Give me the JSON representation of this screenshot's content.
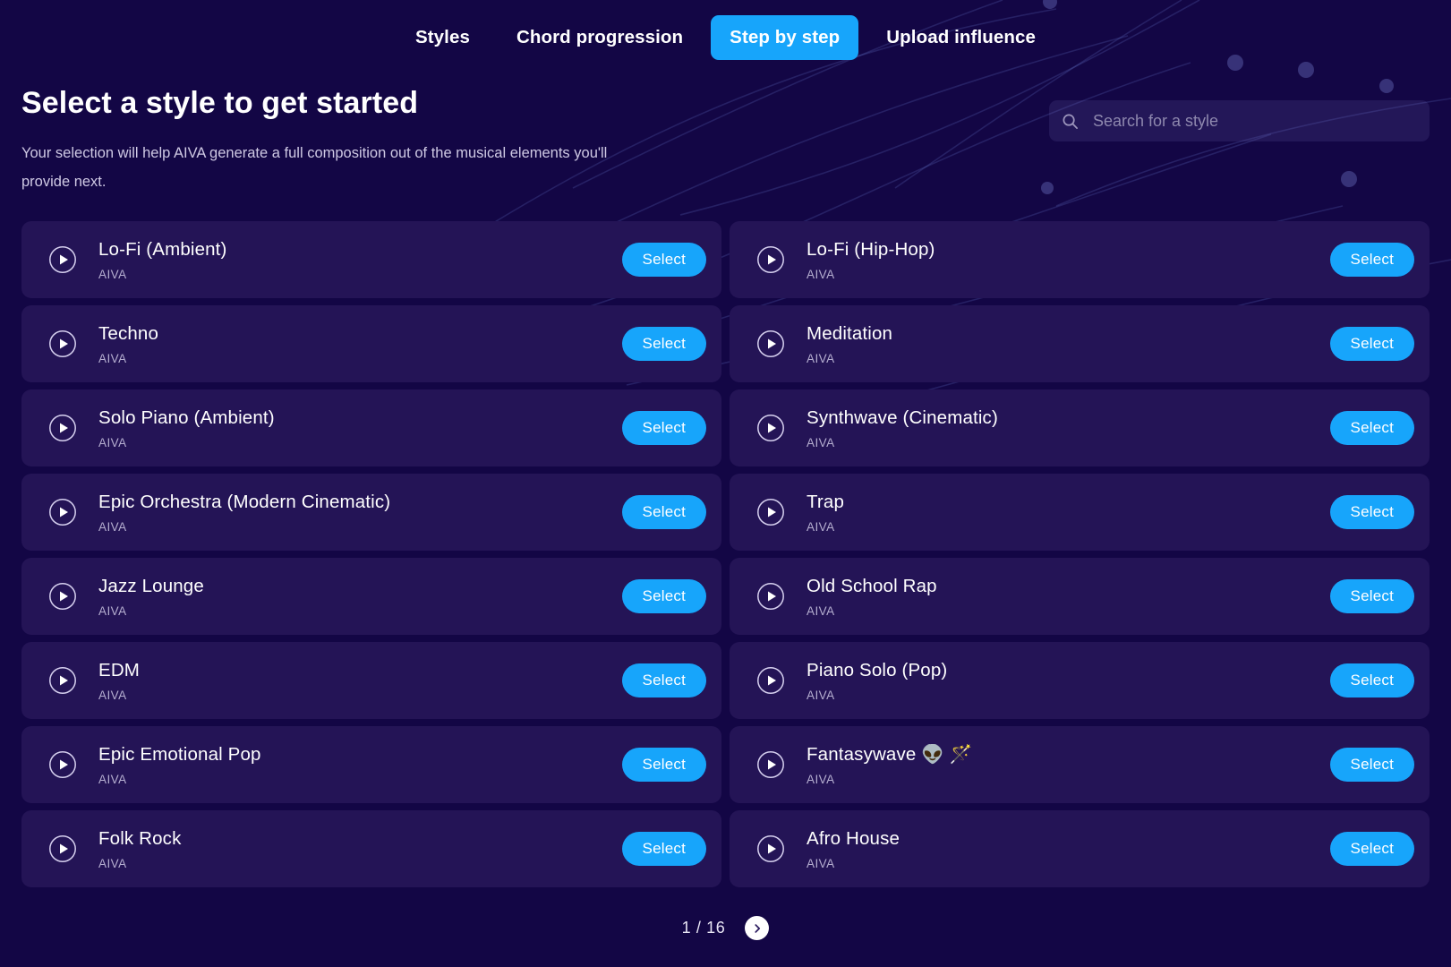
{
  "theme": {
    "background": "#130645",
    "card_background": "#241456",
    "accent": "#17a5fb",
    "title_color": "#ffffff",
    "subtitle_color": "#cfc9e4"
  },
  "tabs": [
    {
      "label": "Styles",
      "active": false
    },
    {
      "label": "Chord progression",
      "active": false
    },
    {
      "label": "Step by step",
      "active": true
    },
    {
      "label": "Upload influence",
      "active": false
    }
  ],
  "header": {
    "title": "Select a style to get started",
    "description": "Your selection will help AIVA generate a full composition out of the musical elements you'll provide next."
  },
  "search": {
    "icon": "search-icon",
    "placeholder": "Search for a style",
    "value": ""
  },
  "styles": [
    {
      "title": "Lo-Fi (Ambient)",
      "author": "AIVA",
      "select_label": "Select",
      "play_icon": "play-circle-icon"
    },
    {
      "title": "Lo-Fi (Hip-Hop)",
      "author": "AIVA",
      "select_label": "Select",
      "play_icon": "play-circle-icon"
    },
    {
      "title": "Techno",
      "author": "AIVA",
      "select_label": "Select",
      "play_icon": "play-circle-icon"
    },
    {
      "title": "Meditation",
      "author": "AIVA",
      "select_label": "Select",
      "play_icon": "play-circle-icon"
    },
    {
      "title": "Solo Piano (Ambient)",
      "author": "AIVA",
      "select_label": "Select",
      "play_icon": "play-circle-icon"
    },
    {
      "title": "Synthwave (Cinematic)",
      "author": "AIVA",
      "select_label": "Select",
      "play_icon": "play-circle-icon"
    },
    {
      "title": "Epic Orchestra (Modern Cinematic)",
      "author": "AIVA",
      "select_label": "Select",
      "play_icon": "play-circle-icon"
    },
    {
      "title": "Trap",
      "author": "AIVA",
      "select_label": "Select",
      "play_icon": "play-circle-icon"
    },
    {
      "title": "Jazz Lounge",
      "author": "AIVA",
      "select_label": "Select",
      "play_icon": "play-circle-icon"
    },
    {
      "title": "Old School Rap",
      "author": "AIVA",
      "select_label": "Select",
      "play_icon": "play-circle-icon"
    },
    {
      "title": "EDM",
      "author": "AIVA",
      "select_label": "Select",
      "play_icon": "play-circle-icon"
    },
    {
      "title": "Piano Solo (Pop)",
      "author": "AIVA",
      "select_label": "Select",
      "play_icon": "play-circle-icon"
    },
    {
      "title": "Epic Emotional Pop",
      "author": "AIVA",
      "select_label": "Select",
      "play_icon": "play-circle-icon"
    },
    {
      "title": "Fantasywave 👽 🪄",
      "author": "AIVA",
      "select_label": "Select",
      "play_icon": "play-circle-icon"
    },
    {
      "title": "Folk Rock",
      "author": "AIVA",
      "select_label": "Select",
      "play_icon": "play-circle-icon"
    },
    {
      "title": "Afro House",
      "author": "AIVA",
      "select_label": "Select",
      "play_icon": "play-circle-icon"
    }
  ],
  "pagination": {
    "label": "1 / 16",
    "current_page": 1,
    "total_pages": 16,
    "next_icon": "chevron-right-icon"
  }
}
